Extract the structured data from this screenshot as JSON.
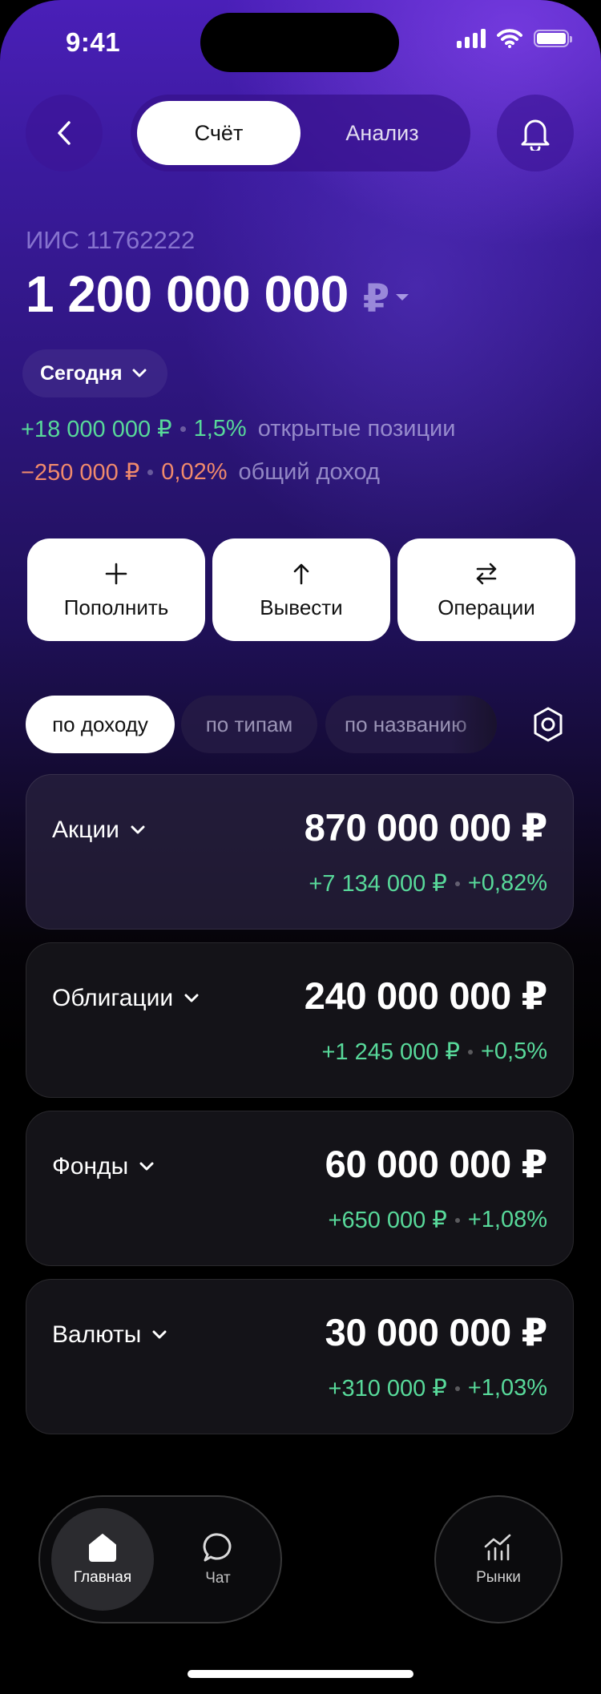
{
  "status_bar": {
    "time": "9:41"
  },
  "header": {
    "segments": [
      {
        "label": "Счёт",
        "active": true
      },
      {
        "label": "Анализ",
        "active": false
      }
    ]
  },
  "account": {
    "label": "ИИС 11762222",
    "balance": "1 200 000 000",
    "currency_symbol": "₽",
    "period": "Сегодня",
    "open_positions": {
      "amount": "+18 000 000 ₽",
      "percent": "1,5%",
      "label": "открытые позиции"
    },
    "total_income": {
      "amount": "−250 000 ₽",
      "percent": "0,02%",
      "label": "общий доход"
    }
  },
  "actions": [
    {
      "label": "Пополнить",
      "icon": "plus-icon"
    },
    {
      "label": "Вывести",
      "icon": "arrow-up-icon"
    },
    {
      "label": "Операции",
      "icon": "swap-arrows-icon"
    }
  ],
  "sort_chips": [
    {
      "label": "по доходу",
      "active": true
    },
    {
      "label": "по типам",
      "active": false
    },
    {
      "label": "по названию",
      "active": false
    }
  ],
  "assets": [
    {
      "name": "Акции",
      "value": "870 000 000 ₽",
      "change": "+7 134 000 ₽",
      "change_pct": "+0,82%"
    },
    {
      "name": "Облигации",
      "value": "240 000 000 ₽",
      "change": "+1 245 000 ₽",
      "change_pct": "+0,5%"
    },
    {
      "name": "Фонды",
      "value": "60 000 000 ₽",
      "change": "+650 000 ₽",
      "change_pct": "+1,08%"
    },
    {
      "name": "Валюты",
      "value": "30 000 000 ₽",
      "change": "+310 000 ₽",
      "change_pct": "+1,03%"
    }
  ],
  "tab_bar": {
    "home": "Главная",
    "chat": "Чат",
    "markets": "Рынки"
  },
  "colors": {
    "positive": "#58d99a",
    "negative": "#f08a6c",
    "accent": "#4a1fb8"
  }
}
